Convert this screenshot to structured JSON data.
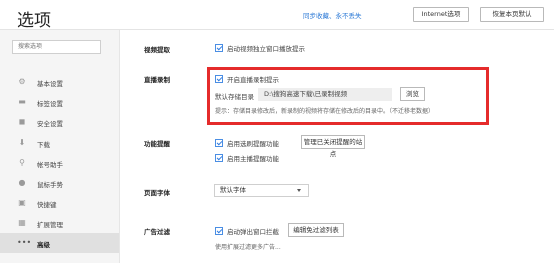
{
  "header": {
    "title": "选项",
    "sync_link": "同步收藏、永不丢失",
    "internet_button": "Internet选项",
    "restore_button": "恢复本页默认"
  },
  "sidebar": {
    "search_placeholder": "搜索选项",
    "items": [
      {
        "label": "基本设置",
        "icon": "gear-icon"
      },
      {
        "label": "标签设置",
        "icon": "tab-icon"
      },
      {
        "label": "安全设置",
        "icon": "shield-icon"
      },
      {
        "label": "下载",
        "icon": "download-icon"
      },
      {
        "label": "帐号助手",
        "icon": "key-icon"
      },
      {
        "label": "鼠标手势",
        "icon": "mouse-icon"
      },
      {
        "label": "快捷键",
        "icon": "keyboard-icon"
      },
      {
        "label": "扩展管理",
        "icon": "grid-icon"
      },
      {
        "label": "高级",
        "icon": "more-icon"
      }
    ]
  },
  "sections": {
    "video": {
      "label": "视频提取",
      "option": "启动视频独立窗口播放提示"
    },
    "live": {
      "label": "直播录制",
      "option": "开启直播录制提示",
      "path_label": "默认存储目录",
      "path_value": "D:\\搜狗高速下载\\已录制视频",
      "browse_button": "浏览",
      "tip": "提示：存储目录修改后，新录制的视频将存储在修改后的目录中。（不迁移老数据）"
    },
    "reminder": {
      "label": "功能提醒",
      "option1": "启用选刷提醒功能",
      "manage_button": "管理已关闭提醒的站点",
      "option2": "启用主播提醒功能"
    },
    "font": {
      "label": "页面字体",
      "selected": "默认字体"
    },
    "ads": {
      "label": "广告过滤",
      "option": "启动弹出窗口拦截",
      "edit_button": "编辑免过滤列表",
      "subtext": "使用扩展过滤更多广告..."
    }
  },
  "colors": {
    "accent": "#2a78d6",
    "highlight": "#e52b2b",
    "checkbox": "#4a8ee4"
  }
}
